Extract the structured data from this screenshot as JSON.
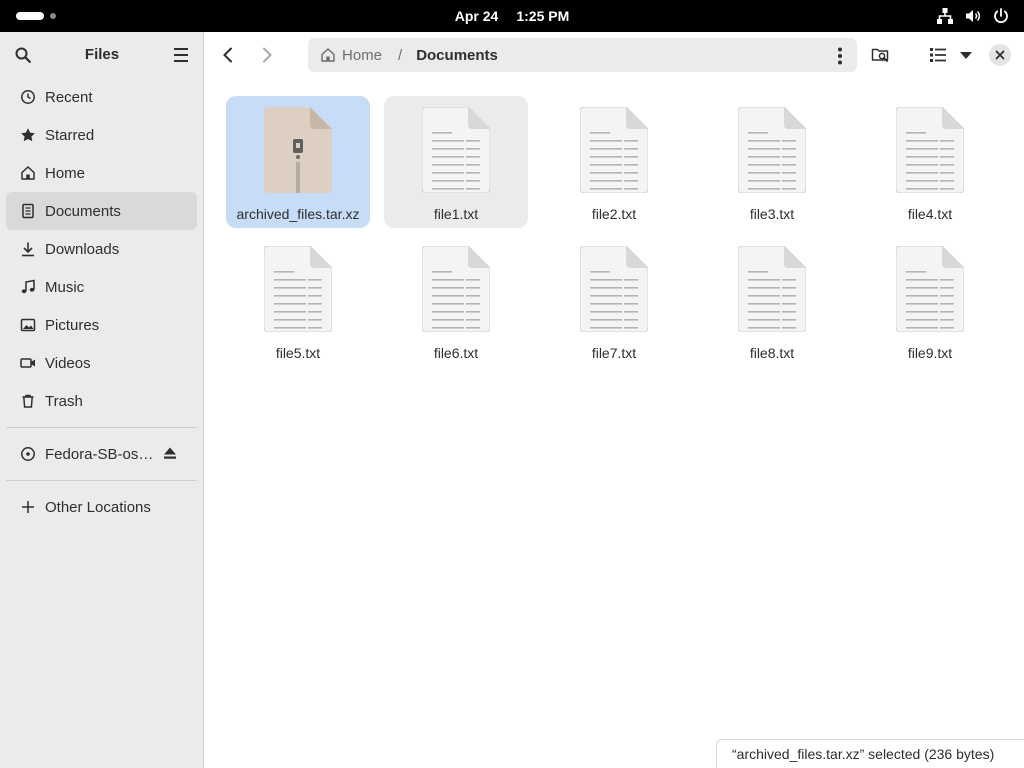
{
  "topbar": {
    "date": "Apr 24",
    "time": "1:25 PM"
  },
  "sidebar": {
    "title": "Files",
    "places": [
      {
        "label": "Recent",
        "icon": "clock-icon",
        "active": false
      },
      {
        "label": "Starred",
        "icon": "star-icon",
        "active": false
      },
      {
        "label": "Home",
        "icon": "home-icon",
        "active": false
      },
      {
        "label": "Documents",
        "icon": "document-icon",
        "active": true
      },
      {
        "label": "Downloads",
        "icon": "download-icon",
        "active": false
      },
      {
        "label": "Music",
        "icon": "music-icon",
        "active": false
      },
      {
        "label": "Pictures",
        "icon": "picture-icon",
        "active": false
      },
      {
        "label": "Videos",
        "icon": "video-icon",
        "active": false
      },
      {
        "label": "Trash",
        "icon": "trash-icon",
        "active": false
      }
    ],
    "device": {
      "label": "Fedora-SB-os…",
      "icon": "disc-icon"
    },
    "other_locations": "Other Locations"
  },
  "header": {
    "path_home": "Home",
    "path_separator": "/",
    "path_current": "Documents"
  },
  "files": [
    {
      "name": "archived_files.tar.xz",
      "type": "archive",
      "state": "selected"
    },
    {
      "name": "file1.txt",
      "type": "text",
      "state": "hover"
    },
    {
      "name": "file2.txt",
      "type": "text",
      "state": ""
    },
    {
      "name": "file3.txt",
      "type": "text",
      "state": ""
    },
    {
      "name": "file4.txt",
      "type": "text",
      "state": ""
    },
    {
      "name": "file5.txt",
      "type": "text",
      "state": ""
    },
    {
      "name": "file6.txt",
      "type": "text",
      "state": ""
    },
    {
      "name": "file7.txt",
      "type": "text",
      "state": ""
    },
    {
      "name": "file8.txt",
      "type": "text",
      "state": ""
    },
    {
      "name": "file9.txt",
      "type": "text",
      "state": ""
    }
  ],
  "status": "“archived_files.tar.xz” selected  (236 bytes)",
  "colors": {
    "selection": "#c6dcf7",
    "sidebar_bg": "#ebebeb",
    "topbar_bg": "#000000"
  }
}
